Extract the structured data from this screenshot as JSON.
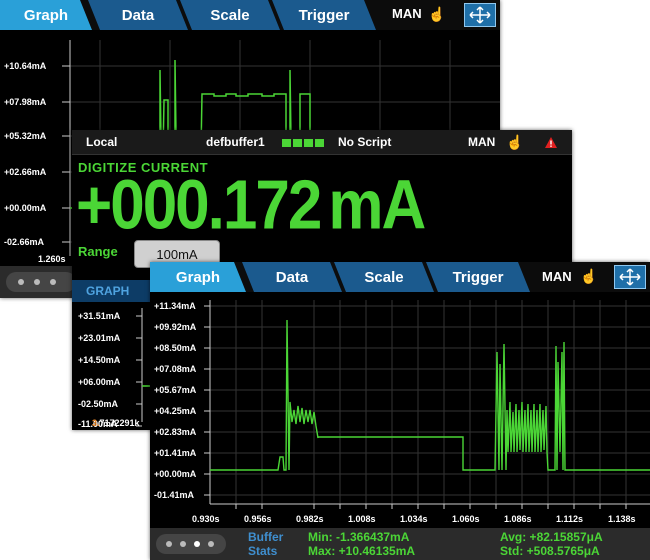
{
  "colors": {
    "trace": "#4bd636",
    "tab": "#1b5a8e",
    "tab_active": "#2aa0d8",
    "stat_title": "#3f8fcf",
    "alert": "#e02020"
  },
  "back_screen": {
    "tabs": [
      {
        "label": "Graph",
        "active": true
      },
      {
        "label": "Data",
        "active": false
      },
      {
        "label": "Scale",
        "active": false
      },
      {
        "label": "Trigger",
        "active": false
      }
    ],
    "mode": "MAN",
    "y_labels": [
      "+10.64mA",
      "+07.98mA",
      "+05.32mA",
      "+02.66mA",
      "+00.00mA",
      "-02.66mA"
    ],
    "x_label": "1.260s"
  },
  "middle_screen": {
    "status": {
      "location": "Local",
      "buffer": "defbuffer1",
      "script": "No Script",
      "mode": "MAN"
    },
    "function_label": "DIGITIZE CURRENT",
    "reading": "+000.172",
    "unit": "mA",
    "range_label": "Range",
    "range_value": "100mA",
    "graph_tab": "GRAPH",
    "y_labels": [
      "+31.51mA",
      "+23.01mA",
      "+14.50mA",
      "+06.00mA",
      "-02.50mA",
      "-11.00mA"
    ],
    "partial_value_prefix": "3.",
    "partial_value": "7172291k"
  },
  "front_screen": {
    "tabs": [
      {
        "label": "Graph",
        "active": true
      },
      {
        "label": "Data",
        "active": false
      },
      {
        "label": "Scale",
        "active": false
      },
      {
        "label": "Trigger",
        "active": false
      }
    ],
    "mode": "MAN",
    "y_labels": [
      "+11.34mA",
      "+09.92mA",
      "+08.50mA",
      "+07.08mA",
      "+05.67mA",
      "+04.25mA",
      "+02.83mA",
      "+01.41mA",
      "+00.00mA",
      "-01.41mA"
    ],
    "x_labels": [
      "0.930s",
      "0.956s",
      "0.982s",
      "1.008s",
      "1.034s",
      "1.060s",
      "1.086s",
      "1.112s",
      "1.138s"
    ],
    "stats_title_1": "Buffer",
    "stats_title_2": "Stats",
    "min": "Min: -1.366437mA",
    "max": "Max: +10.46135mA",
    "avg": "Avg: +82.15857μA",
    "std": "Std: +508.5765μA"
  }
}
